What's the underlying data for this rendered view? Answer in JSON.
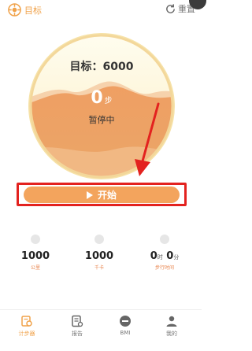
{
  "header": {
    "target_label": "目标",
    "reset_label": "重置"
  },
  "progress": {
    "goal_text": "目标：6000",
    "steps_value": "0",
    "steps_unit": "步",
    "status_text": "暂停中"
  },
  "action": {
    "start_label": "开始"
  },
  "stats": [
    {
      "value": "1000",
      "label": "公里"
    },
    {
      "value": "1000",
      "label": "千卡"
    },
    {
      "value_hours": "0",
      "unit_hours": "时",
      "value_minutes": "0",
      "unit_minutes": "分",
      "label": "步行时间"
    }
  ],
  "tabs": [
    {
      "label": "计步器"
    },
    {
      "label": "报告"
    },
    {
      "label": "BMI"
    },
    {
      "label": "我的"
    }
  ],
  "colors": {
    "accent": "#f0a24a",
    "button": "#f3a45d",
    "annotation_red": "#e3221f"
  }
}
